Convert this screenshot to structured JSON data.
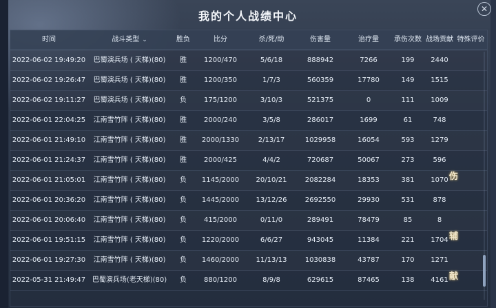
{
  "title": "我的个人战绩中心",
  "close_label": "✕",
  "columns": {
    "time": "时间",
    "type": "战斗类型",
    "result": "胜负",
    "score": "比分",
    "kda": "杀/死/助",
    "damage": "伤害量",
    "heal": "治疗量",
    "hits": "承伤次数",
    "contrib": "战场贡献",
    "eval": "特殊评价"
  },
  "filter_icon": "⌄",
  "rows": [
    {
      "time": "2022-06-02 19:49:20",
      "type": "巴蜀演兵场 ( 天梯)(80)",
      "result": "胜",
      "score": "1200/470",
      "kda": "5/6/18",
      "damage": "888942",
      "heal": "7266",
      "hits": "199",
      "contrib": "2440"
    },
    {
      "time": "2022-06-02 19:26:47",
      "type": "巴蜀演兵场 ( 天梯)(80)",
      "result": "胜",
      "score": "1200/350",
      "kda": "1/7/3",
      "damage": "560359",
      "heal": "17780",
      "hits": "149",
      "contrib": "1515"
    },
    {
      "time": "2022-06-02 19:11:27",
      "type": "巴蜀演兵场 ( 天梯)(80)",
      "result": "负",
      "score": "175/1200",
      "kda": "3/10/3",
      "damage": "521375",
      "heal": "0",
      "hits": "111",
      "contrib": "1009"
    },
    {
      "time": "2022-06-01 22:04:25",
      "type": "江南雪竹阵 ( 天梯)(80)",
      "result": "胜",
      "score": "2000/240",
      "kda": "3/5/8",
      "damage": "286017",
      "heal": "1699",
      "hits": "61",
      "contrib": "748"
    },
    {
      "time": "2022-06-01 21:49:10",
      "type": "江南雪竹阵 ( 天梯)(80)",
      "result": "胜",
      "score": "2000/1330",
      "kda": "2/13/17",
      "damage": "1029958",
      "heal": "16054",
      "hits": "593",
      "contrib": "1279"
    },
    {
      "time": "2022-06-01 21:24:37",
      "type": "江南雪竹阵 ( 天梯)(80)",
      "result": "胜",
      "score": "2000/425",
      "kda": "4/4/2",
      "damage": "720687",
      "heal": "50067",
      "hits": "273",
      "contrib": "596"
    },
    {
      "time": "2022-06-01 21:05:01",
      "type": "江南雪竹阵 ( 天梯)(80)",
      "result": "负",
      "score": "1145/2000",
      "kda": "20/10/21",
      "damage": "2082284",
      "heal": "18353",
      "hits": "381",
      "contrib": "1070"
    },
    {
      "time": "2022-06-01 20:36:20",
      "type": "江南雪竹阵 ( 天梯)(80)",
      "result": "负",
      "score": "1445/2000",
      "kda": "13/12/26",
      "damage": "2692550",
      "heal": "29930",
      "hits": "531",
      "contrib": "878"
    },
    {
      "time": "2022-06-01 20:06:40",
      "type": "江南雪竹阵 ( 天梯)(80)",
      "result": "负",
      "score": "415/2000",
      "kda": "0/11/0",
      "damage": "289491",
      "heal": "78479",
      "hits": "85",
      "contrib": "8"
    },
    {
      "time": "2022-06-01 19:51:15",
      "type": "江南雪竹阵 ( 天梯)(80)",
      "result": "负",
      "score": "1220/2000",
      "kda": "6/6/27",
      "damage": "943045",
      "heal": "11384",
      "hits": "221",
      "contrib": "1704"
    },
    {
      "time": "2022-06-01 19:27:30",
      "type": "江南雪竹阵 ( 天梯)(80)",
      "result": "负",
      "score": "1460/2000",
      "kda": "11/13/13",
      "damage": "1030838",
      "heal": "43787",
      "hits": "170",
      "contrib": "1271"
    },
    {
      "time": "2022-05-31 21:49:47",
      "type": "巴蜀演兵场(老天梯)(80)",
      "result": "负",
      "score": "880/1200",
      "kda": "8/9/8",
      "damage": "629615",
      "heal": "87465",
      "hits": "138",
      "contrib": "4161"
    }
  ],
  "badges": [
    "伤",
    "辅",
    "献"
  ]
}
